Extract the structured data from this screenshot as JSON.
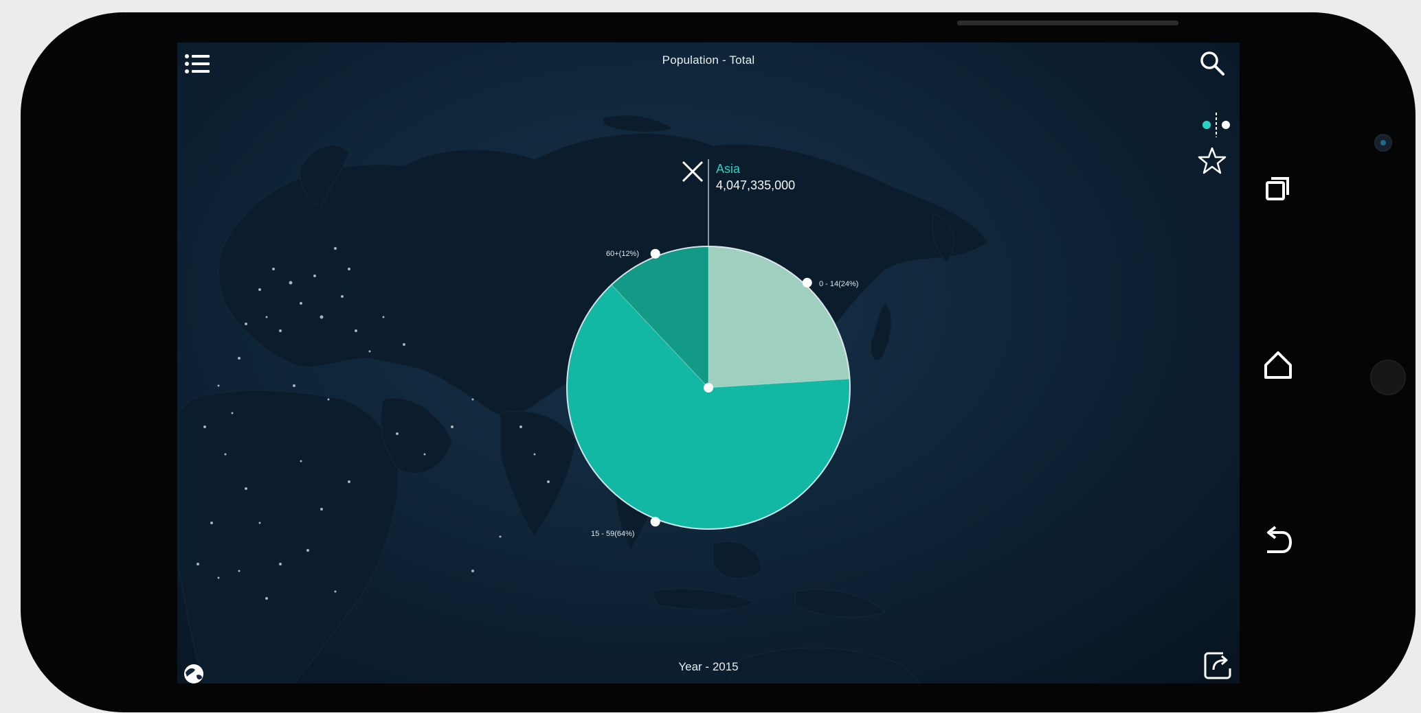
{
  "header": {
    "title": "Population - Total"
  },
  "footer": {
    "year": "Year - 2015"
  },
  "selection": {
    "region": "Asia",
    "value": "4,047,335,000"
  },
  "pie_segments": [
    {
      "label": "0 - 14(24%)",
      "fraction": 0.24,
      "color": "#9fcfbf"
    },
    {
      "label": "15 - 59(64%)",
      "fraction": 0.64,
      "color": "#13b8a5"
    },
    {
      "label": "60+(12%)",
      "fraction": 0.12,
      "color": "#129a86"
    }
  ],
  "icons": {
    "menu": "list-icon",
    "search": "search-icon",
    "favorite": "star-icon",
    "share": "share-icon",
    "globe": "globe-icon",
    "close": "close-icon",
    "recents": "recents-icon",
    "home": "home-icon",
    "back": "back-icon"
  },
  "colors": {
    "accent": "#27d4c4",
    "screen_bg": "#0f2539",
    "land": "#0b1c2c"
  }
}
